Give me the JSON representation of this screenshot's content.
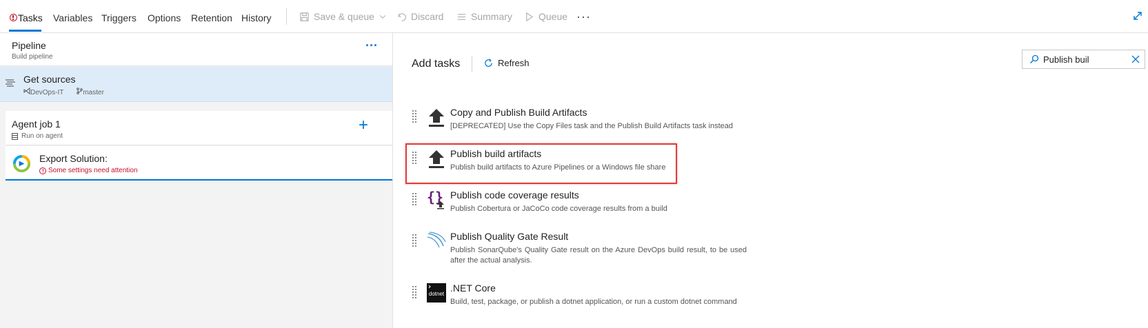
{
  "tabs": [
    {
      "label": "Tasks"
    },
    {
      "label": "Variables"
    },
    {
      "label": "Triggers"
    },
    {
      "label": "Options"
    },
    {
      "label": "Retention"
    },
    {
      "label": "History"
    }
  ],
  "commands": {
    "save_queue": "Save & queue",
    "discard": "Discard",
    "summary": "Summary",
    "queue": "Queue",
    "more": "···"
  },
  "pipeline": {
    "title": "Pipeline",
    "subtitle": "Build pipeline",
    "more": "···"
  },
  "sources": {
    "title": "Get sources",
    "repo": "DevOps-IT",
    "branch": "master"
  },
  "agent_job": {
    "title": "Agent job 1",
    "subtitle": "Run on agent",
    "add": "+"
  },
  "export_task": {
    "title": "Export Solution:",
    "warning": "Some settings need attention"
  },
  "add_tasks": {
    "title": "Add tasks",
    "refresh": "Refresh",
    "search_value": "Publish buil"
  },
  "tasks": [
    {
      "name": "Copy and Publish Build Artifacts",
      "desc": "[DEPRECATED] Use the Copy Files task and the Publish Build Artifacts task instead",
      "icon": "upload-icon"
    },
    {
      "name": "Publish build artifacts",
      "desc": "Publish build artifacts to Azure Pipelines or a Windows file share",
      "icon": "upload-icon"
    },
    {
      "name": "Publish code coverage results",
      "desc": "Publish Cobertura or JaCoCo code coverage results from a build",
      "icon": "code-coverage-icon"
    },
    {
      "name": "Publish Quality Gate Result",
      "desc": "Publish SonarQube's Quality Gate result on the Azure DevOps build result, to be used after the actual analysis.",
      "icon": "sonarqube-icon"
    },
    {
      "name": ".NET Core",
      "desc": "Build, test, package, or publish a dotnet application, or run a custom dotnet command",
      "icon": "dotnet-icon",
      "icon_label": "dotnet"
    }
  ],
  "colors": {
    "accent": "#0078d4",
    "error": "#c8102e",
    "highlight": "#e03c3c",
    "selected_bg": "#deecf9"
  }
}
